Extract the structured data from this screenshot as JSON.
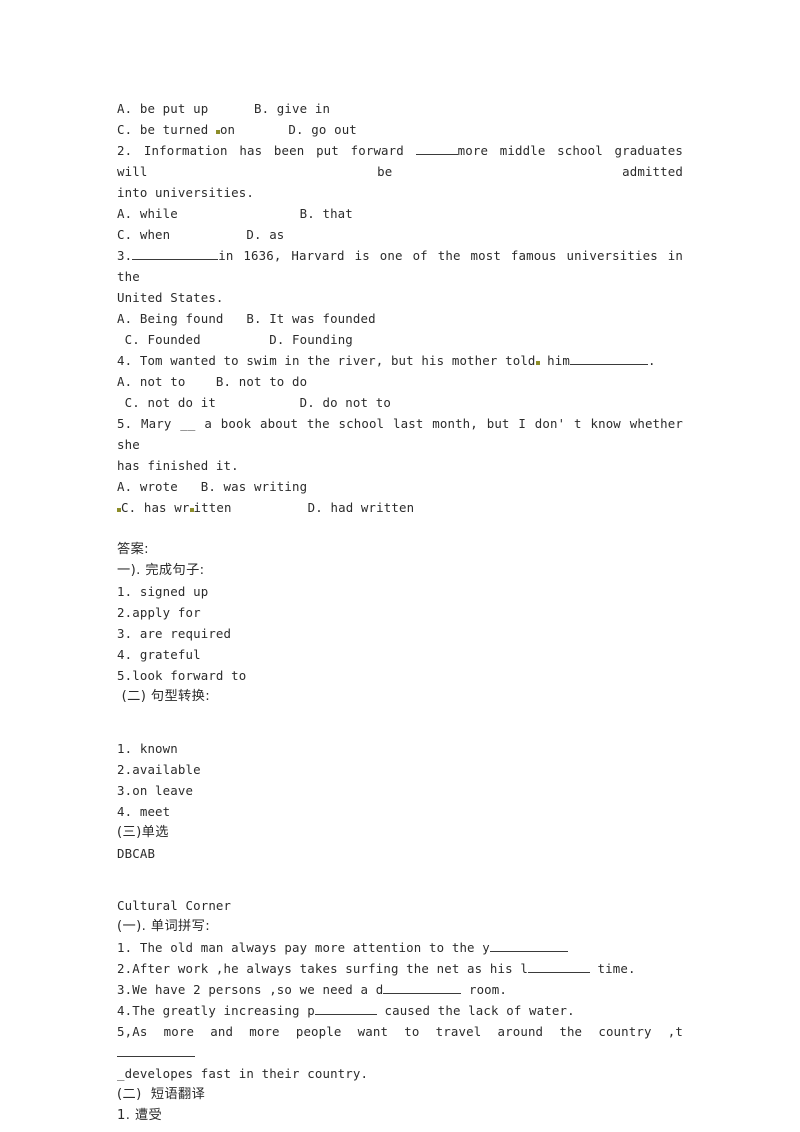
{
  "document": {
    "background_color": "#ffffff",
    "text_color": "#2b2b2b",
    "marker_color": "#8d8d29"
  },
  "multiple_choice_tail": {
    "q1_options_line1": "A. be put up      B. give in",
    "q1_options_line2_a": "C. be turned ",
    "q1_options_line2_b": "on       D. go out",
    "q2_stem_line1": "2. Information has been put forward ",
    "q2_stem_line1_after": "more middle school graduates will be admitted",
    "q2_stem_line2": "into universities.",
    "q2_options_line1": "A. while                B. that",
    "q2_options_line2": "C. when          D. as",
    "q3_number": "3.",
    "q3_stem_after_blank": "in 1636, Harvard is one of the most famous universities in the",
    "q3_stem_line2": "United States.",
    "q3_options_line1": "A. Being found   B. It was founded",
    "q3_options_line2": " C. Founded         D. Founding",
    "q4_stem_a": "4. Tom wanted to swim in the river, but his mother told",
    "q4_stem_b": " him",
    "q4_stem_c": ".",
    "q4_options_line1": "A. not to    B. not to do",
    "q4_options_line2": " C. not do it           D. do not to",
    "q5_stem_a": "5. Mary __ a book about the school last month, but I don'",
    "q5_stem_b": " t know whether she",
    "q5_stem_line2": "has finished it.",
    "q5_options_line1": "A. wrote   B. was writing",
    "q5_options_line2_a": "C. has wr",
    "q5_options_line2_b": "itten          D. had written"
  },
  "answers": {
    "heading": "答案:",
    "section_one_title": "一). 完成句子:",
    "section_one_items": [
      "1. signed up",
      "2.apply for",
      "3. are required",
      "4. grateful",
      "5.look forward to"
    ],
    "section_two_title": " (二) 句型转换:",
    "section_two_items": [
      "1. known",
      "2.available",
      "3.on leave",
      "4. meet"
    ],
    "section_three_title": "(三)单选",
    "section_three_answer": "DBCAB"
  },
  "cultural_corner": {
    "title": "Cultural Corner",
    "part_one_title": "(一). 单词拼写:",
    "items": [
      {
        "prefix": "1. The old man always pay more attention to the y",
        "suffix": "",
        "blank": "ul-lg"
      },
      {
        "prefix": "2.After work ,he always takes surfing the net as his l",
        "suffix": " time.",
        "blank": "ul-md"
      },
      {
        "prefix": "3.We have 2 persons ,so we need a d",
        "suffix": " room.",
        "blank": "ul-lg"
      },
      {
        "prefix": "4.The greatly increasing p",
        "suffix": " caused the lack of water.",
        "blank": "ul-md"
      }
    ],
    "item5_line1": "5,As  more  and  more  people  want  to  travel  around  the  country  ,t",
    "item5_line2": "_developes fast in their country.",
    "part_two_title": "(二)  短语翻译",
    "part_two_item1": "1. 遭受"
  }
}
